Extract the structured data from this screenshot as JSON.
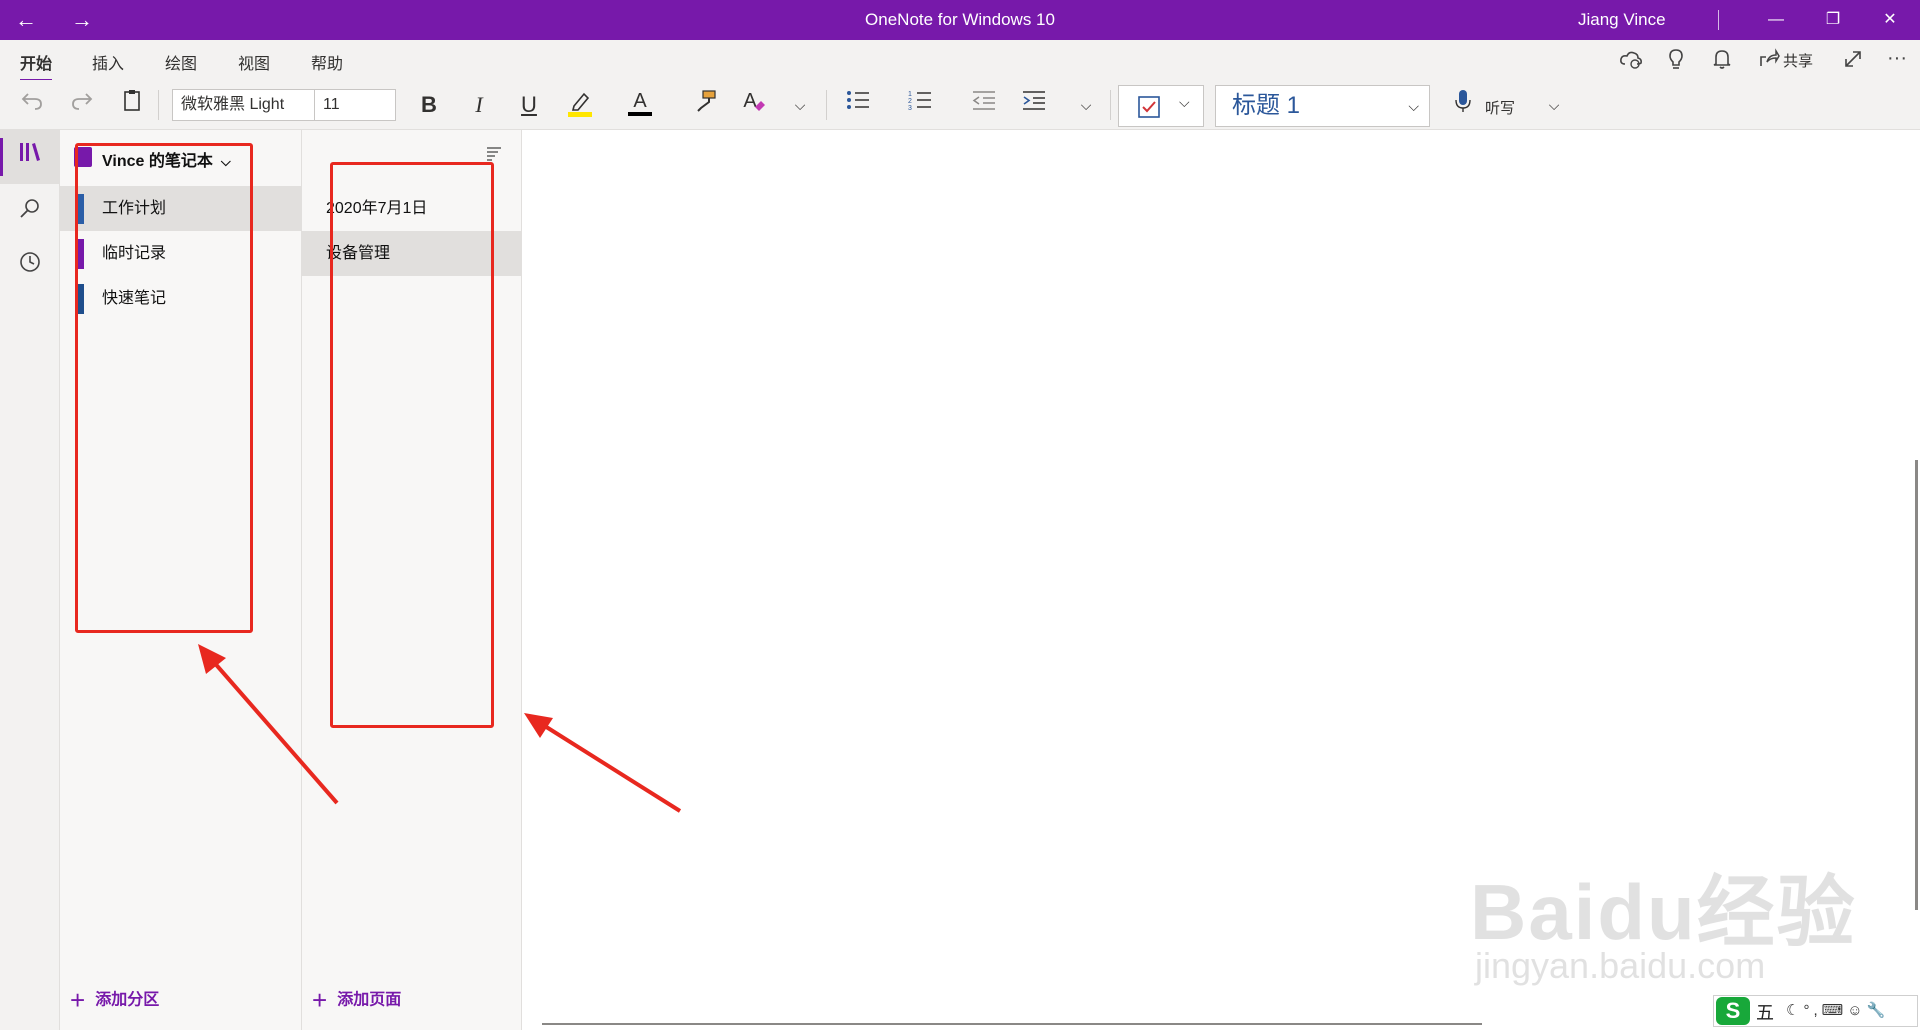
{
  "window": {
    "title": "OneNote for Windows 10",
    "user": "Jiang Vince",
    "back_glyph": "←",
    "forward_glyph": "→",
    "minimize_glyph": "—",
    "restore_glyph": "❐",
    "close_glyph": "✕"
  },
  "ribbon": {
    "tabs": [
      {
        "label": "开始",
        "active": true
      },
      {
        "label": "插入",
        "active": false
      },
      {
        "label": "绘图",
        "active": false
      },
      {
        "label": "视图",
        "active": false
      },
      {
        "label": "帮助",
        "active": false
      }
    ],
    "share_label": "共享"
  },
  "toolbar": {
    "font_name": "微软雅黑 Light",
    "font_size": "11",
    "bold": "B",
    "italic": "I",
    "underline": "U",
    "font_color_glyph": "A",
    "clear_format_glyph": "A",
    "style": "标题 1",
    "dictate_label": "听写",
    "highlight_color": "#ffe600",
    "font_color": "#000000"
  },
  "notebook": {
    "name": "Vince 的笔记本",
    "sections": [
      {
        "name": "工作计划",
        "color": "#2b5ea7",
        "selected": true
      },
      {
        "name": "临时记录",
        "color": "#7719aa",
        "selected": false
      },
      {
        "name": "快速笔记",
        "color": "#1f4e8c",
        "selected": false
      }
    ],
    "add_section_label": "添加分区"
  },
  "pages": {
    "items": [
      {
        "title": "2020年7月1日",
        "selected": false
      },
      {
        "title": "设备管理",
        "selected": true
      }
    ],
    "add_page_label": "添加页面"
  },
  "watermark": {
    "brand": "Baidu经验",
    "url": "jingyan.baidu.com"
  },
  "ime": {
    "logo": "S",
    "mode": "五"
  },
  "colors": {
    "accent": "#7719aa",
    "annotation": "#e8281f"
  }
}
